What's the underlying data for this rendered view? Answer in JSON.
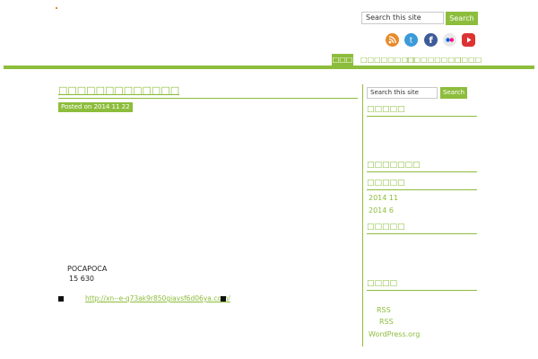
{
  "header": {
    "search_placeholder": "Search this site",
    "search_button": "Search"
  },
  "social": [
    "rss-icon",
    "twitter-icon",
    "facebook-icon",
    "flickr-icon",
    "youtube-icon"
  ],
  "nav": {
    "items": [
      "□□□",
      "□□□□□□□□",
      "□□□□□□□□",
      "□□□□"
    ]
  },
  "post": {
    "title": "□□□□□□□□□□□□□",
    "posted_on": "Posted on 2014 11 22",
    "line1": "POCAPOCA",
    "line2": "15  630",
    "link": "http://xn--e-q73ak9r850giavsf6d06ya.com/"
  },
  "sidebar": {
    "search_placeholder": "Search this site",
    "search_button": "Search",
    "heading1": "□□□□□",
    "heading2": "□□□□□□□",
    "heading3": "□□□□□",
    "archive": [
      "2014 11",
      "2014 6"
    ],
    "heading4": "□□□□□",
    "heading5": "□□□□",
    "meta": [
      "RSS",
      "RSS",
      "WordPress.org"
    ]
  },
  "colors": {
    "accent": "#8dbd3c"
  }
}
